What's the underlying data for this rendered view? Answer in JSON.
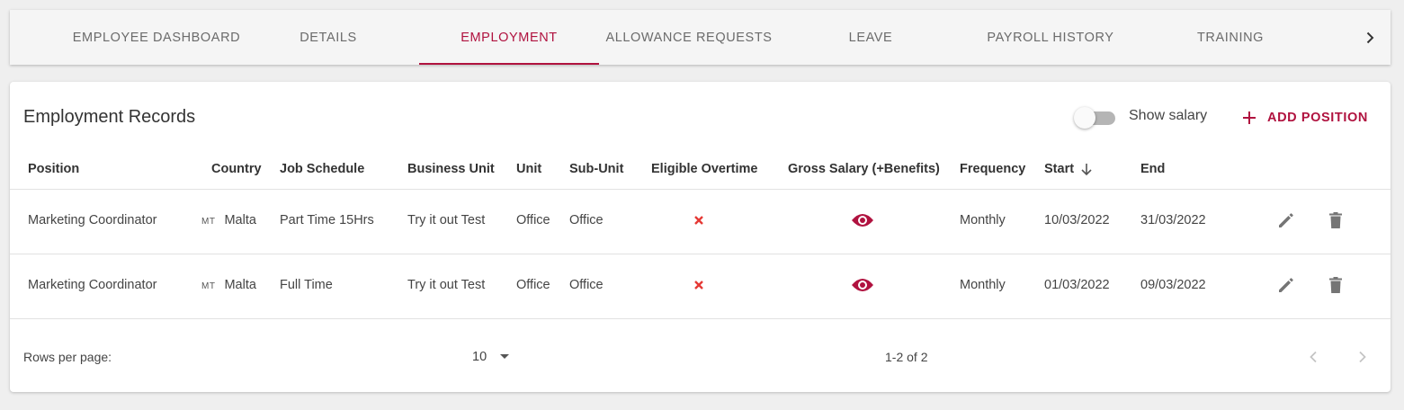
{
  "tabs": [
    {
      "label": "EMPLOYEE DASHBOARD",
      "active": false
    },
    {
      "label": "DETAILS",
      "active": false
    },
    {
      "label": "EMPLOYMENT",
      "active": true
    },
    {
      "label": "ALLOWANCE REQUESTS",
      "active": false
    },
    {
      "label": "LEAVE",
      "active": false
    },
    {
      "label": "PAYROLL HISTORY",
      "active": false
    },
    {
      "label": "TRAINING",
      "active": false
    }
  ],
  "card": {
    "title": "Employment Records",
    "show_salary_label": "Show salary",
    "show_salary_on": false,
    "add_position_label": "ADD POSITION"
  },
  "table": {
    "columns": [
      "Position",
      "Country",
      "Job Schedule",
      "Business Unit",
      "Unit",
      "Sub-Unit",
      "Eligible Overtime",
      "Gross Salary (+Benefits)",
      "Frequency",
      "Start",
      "End"
    ],
    "sort_column": "Start",
    "sort_direction": "descending",
    "rows": [
      {
        "position": "Marketing Coordinator",
        "country_code": "MT",
        "country": "Malta",
        "job_schedule": "Part Time 15Hrs",
        "business_unit": "Try it out Test",
        "unit": "Office",
        "sub_unit": "Office",
        "eligible_overtime": false,
        "frequency": "Monthly",
        "start": "10/03/2022",
        "end": "31/03/2022"
      },
      {
        "position": "Marketing Coordinator",
        "country_code": "MT",
        "country": "Malta",
        "job_schedule": "Full Time",
        "business_unit": "Try it out Test",
        "unit": "Office",
        "sub_unit": "Office",
        "eligible_overtime": false,
        "frequency": "Monthly",
        "start": "01/03/2022",
        "end": "09/03/2022"
      }
    ]
  },
  "pagination": {
    "rows_per_page_label": "Rows per page:",
    "rows_per_page": "10",
    "range": "1-2 of 2"
  },
  "colors": {
    "accent": "#b0123f",
    "cross": "#e53935",
    "icon_grey": "#757575"
  }
}
